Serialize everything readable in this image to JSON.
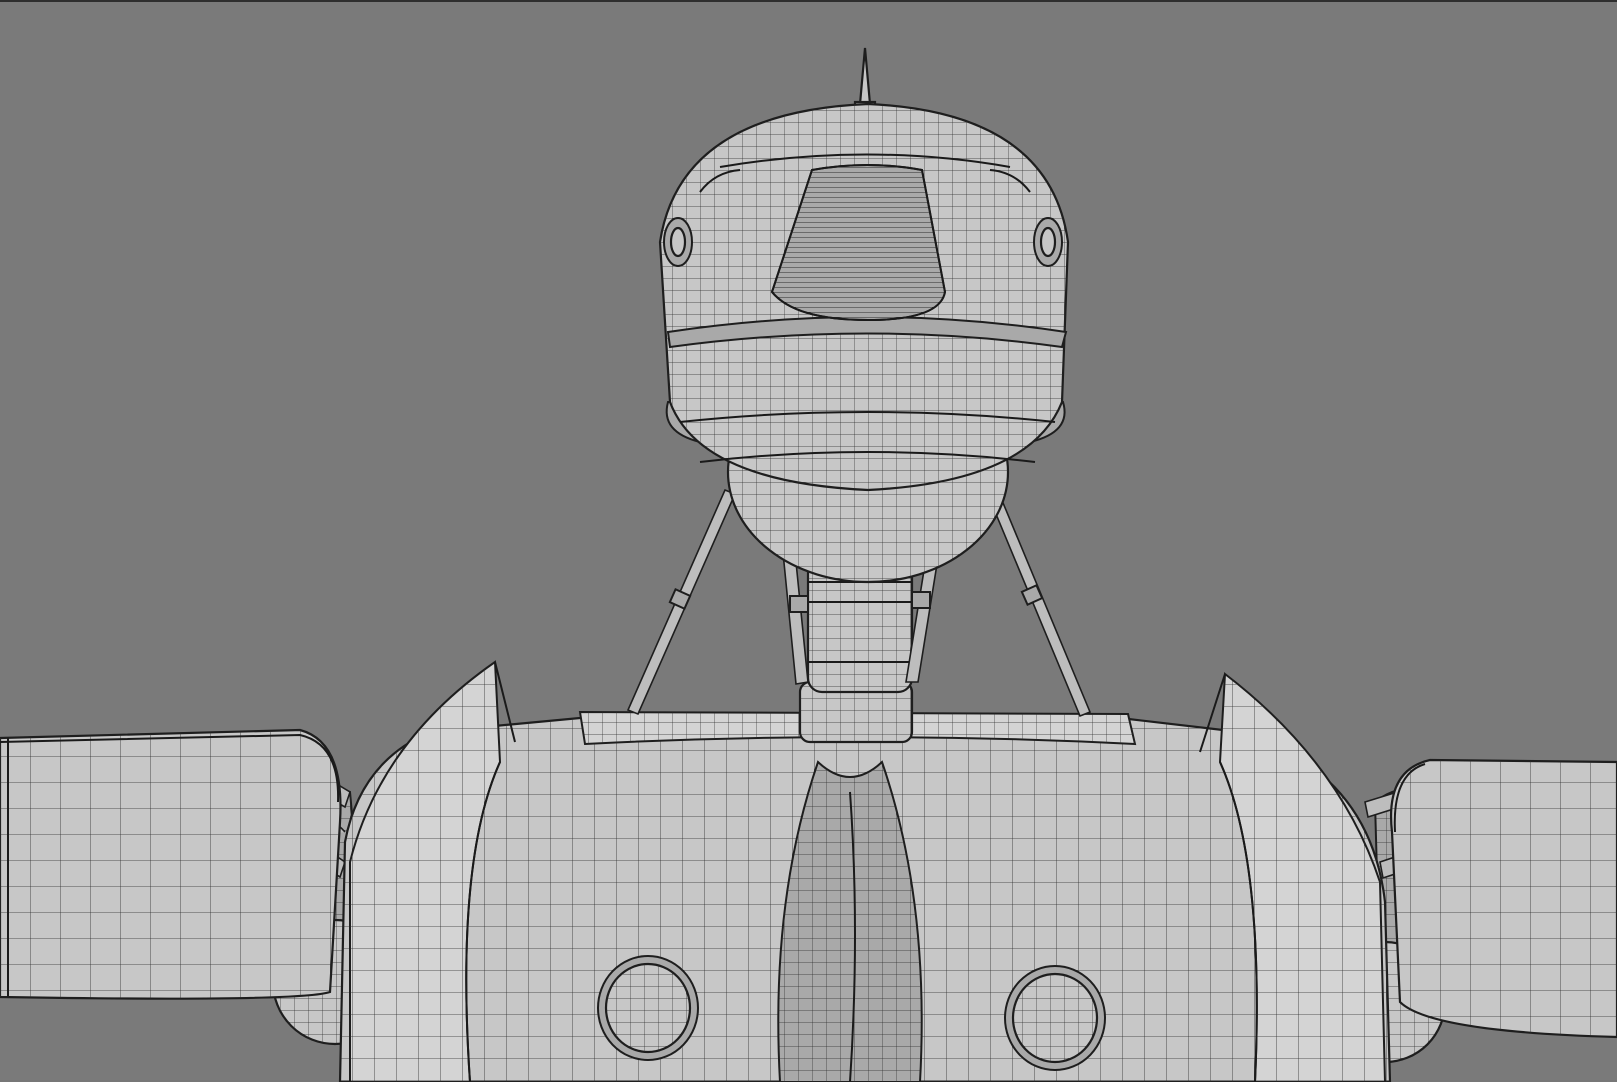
{
  "viewport": {
    "view": "perspective",
    "display_mode": "wireframe-on-shaded",
    "subject": "robot-model",
    "colors": {
      "background": "#7a7a7a",
      "surface": "#c7c7c7",
      "wire": "#2a2a2a"
    }
  }
}
